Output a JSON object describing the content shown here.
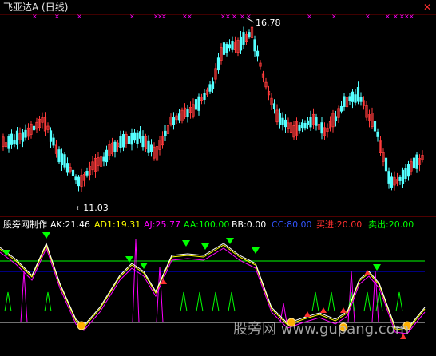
{
  "window": {
    "title": "飞亚达A (日线)",
    "close_glyph": "✕"
  },
  "price": {
    "high_label": "16.78",
    "low_label": "11.03"
  },
  "indicator": {
    "name": "股旁网制作",
    "ak": "AK:21.46",
    "ad1": "AD1:19.31",
    "aj": "AJ:25.77",
    "aa": "AA:100.00",
    "bb": "BB:0.00",
    "cc": "CC:80.00",
    "buy": "买进:20.00",
    "sell": "卖出:20.00"
  },
  "colors": {
    "up_candle": "#ff3b3b",
    "down_candle": "#54ffff",
    "marker": "#ff00ff",
    "line_ak": "#ffffff",
    "line_ad1": "#ffff00",
    "line_aj": "#ff00ff",
    "level_green": "#00ff00",
    "level_blue": "#0000ff",
    "buy_color": "#ff3030",
    "sell_color": "#00ff00",
    "cc_color": "#3355ff"
  },
  "watermark": {
    "text": "股旁网 www.gupang.com"
  }
}
